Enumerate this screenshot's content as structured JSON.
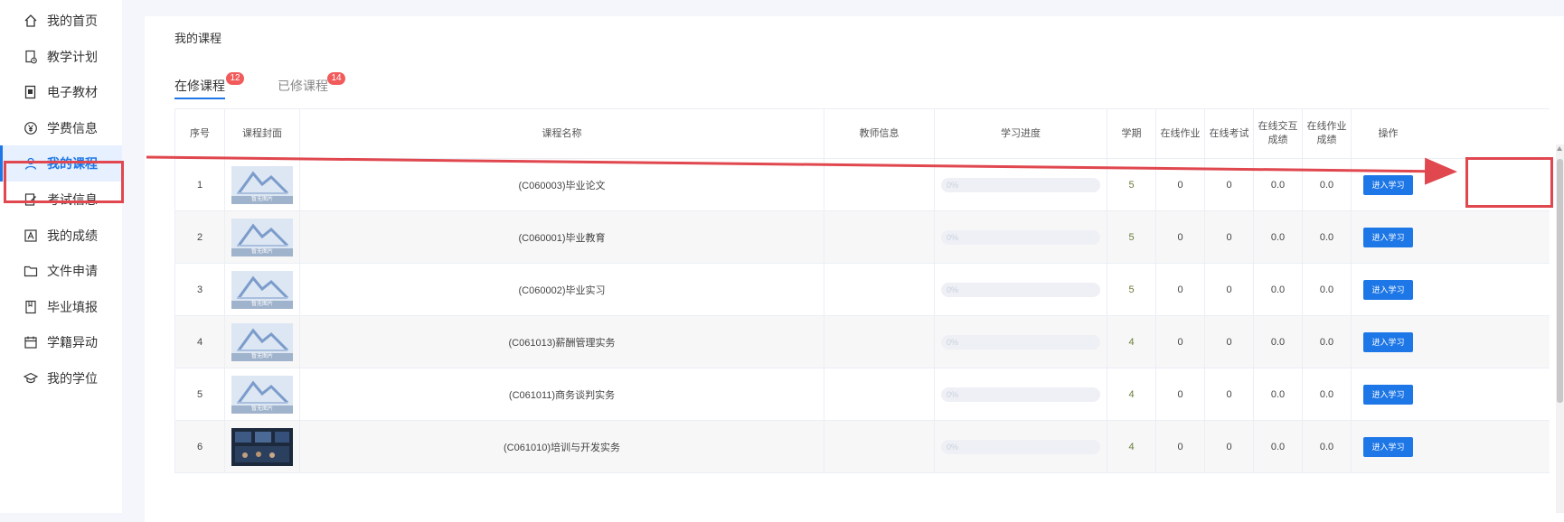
{
  "sidebar": {
    "items": [
      {
        "label": "我的首页",
        "icon": "home-icon"
      },
      {
        "label": "教学计划",
        "icon": "document-clock-icon"
      },
      {
        "label": "电子教材",
        "icon": "ebook-icon"
      },
      {
        "label": "学费信息",
        "icon": "yen-coin-icon"
      },
      {
        "label": "我的课程",
        "icon": "user-icon",
        "active": true
      },
      {
        "label": "考试信息",
        "icon": "edit-note-icon"
      },
      {
        "label": "我的成绩",
        "icon": "grade-card-icon"
      },
      {
        "label": "文件申请",
        "icon": "folder-icon"
      },
      {
        "label": "毕业填报",
        "icon": "bookmark-book-icon"
      },
      {
        "label": "学籍异动",
        "icon": "calendar-icon"
      },
      {
        "label": "我的学位",
        "icon": "graduation-cap-icon"
      }
    ]
  },
  "main": {
    "title": "我的课程",
    "tabs": [
      {
        "label": "在修课程",
        "badge": "12",
        "active": true
      },
      {
        "label": "已修课程",
        "badge": "14",
        "active": false
      }
    ],
    "table": {
      "headers": [
        "序号",
        "课程封面",
        "课程名称",
        "教师信息",
        "学习进度",
        "学期",
        "在线作业",
        "在线考试",
        "在线交互成绩",
        "在线作业成绩",
        "操作"
      ],
      "cover_caption": "暂无图片",
      "rows": [
        {
          "index": "1",
          "cover": "placeholder",
          "name": "(C060003)毕业论文",
          "teacher": "",
          "progress_text": "0%",
          "progress": 0,
          "term": "5",
          "online_homework": "0",
          "online_exam": "0",
          "interaction_score": "0.0",
          "homework_score": "0.0",
          "action": "进入学习"
        },
        {
          "index": "2",
          "cover": "placeholder",
          "name": "(C060001)毕业教育",
          "teacher": "",
          "progress_text": "0%",
          "progress": 0,
          "term": "5",
          "online_homework": "0",
          "online_exam": "0",
          "interaction_score": "0.0",
          "homework_score": "0.0",
          "action": "进入学习"
        },
        {
          "index": "3",
          "cover": "placeholder",
          "name": "(C060002)毕业实习",
          "teacher": "",
          "progress_text": "0%",
          "progress": 0,
          "term": "5",
          "online_homework": "0",
          "online_exam": "0",
          "interaction_score": "0.0",
          "homework_score": "0.0",
          "action": "进入学习"
        },
        {
          "index": "4",
          "cover": "placeholder",
          "name": "(C061013)薪酬管理实务",
          "teacher": "",
          "progress_text": "0%",
          "progress": 0,
          "term": "4",
          "online_homework": "0",
          "online_exam": "0",
          "interaction_score": "0.0",
          "homework_score": "0.0",
          "action": "进入学习"
        },
        {
          "index": "5",
          "cover": "placeholder",
          "name": "(C061011)商务谈判实务",
          "teacher": "",
          "progress_text": "0%",
          "progress": 0,
          "term": "4",
          "online_homework": "0",
          "online_exam": "0",
          "interaction_score": "0.0",
          "homework_score": "0.0",
          "action": "进入学习"
        },
        {
          "index": "6",
          "cover": "photo",
          "name": "(C061010)培训与开发实务",
          "teacher": "",
          "progress_text": "0%",
          "progress": 0,
          "term": "4",
          "online_homework": "0",
          "online_exam": "0",
          "interaction_score": "0.0",
          "homework_score": "0.0",
          "action": "进入学习"
        }
      ]
    }
  },
  "colors": {
    "accent": "#1e77e6",
    "badge": "#f25b5b",
    "annotation": "#e0474e"
  }
}
